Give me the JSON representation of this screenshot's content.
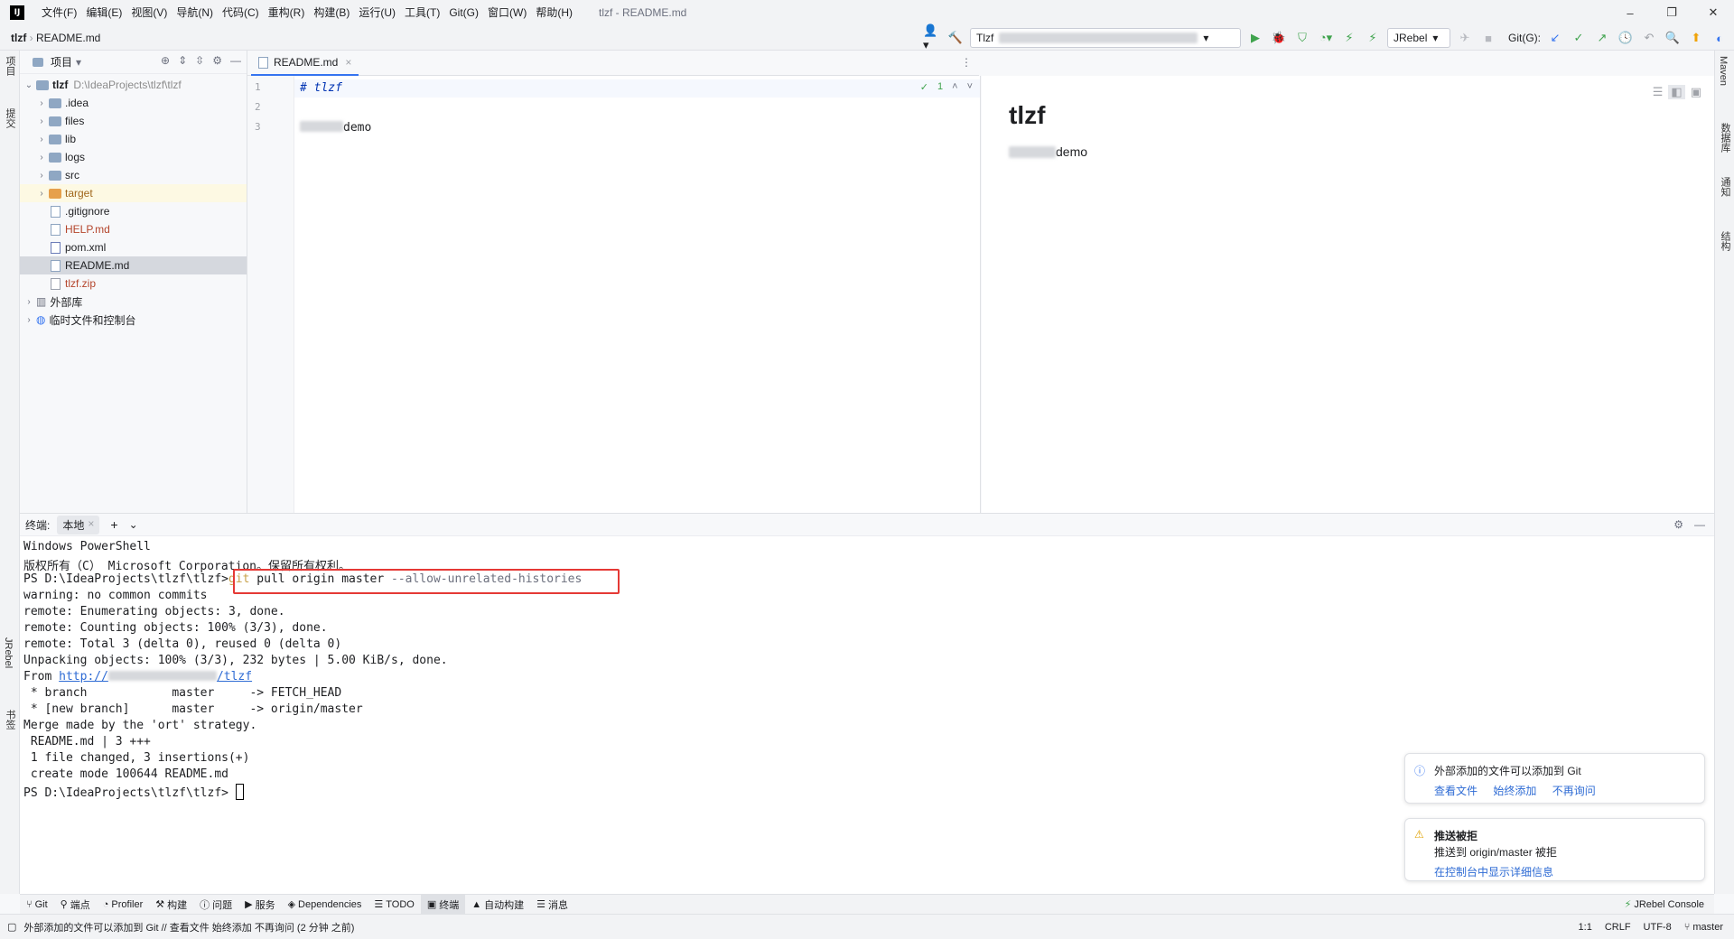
{
  "titlebar": {
    "menu": [
      "文件(F)",
      "编辑(E)",
      "视图(V)",
      "导航(N)",
      "代码(C)",
      "重构(R)",
      "构建(B)",
      "运行(U)",
      "工具(T)",
      "Git(G)",
      "窗口(W)",
      "帮助(H)"
    ],
    "window_title": "tlzf - README.md",
    "minimize": "–",
    "maximize": "❐",
    "close": "✕"
  },
  "navbar": {
    "project": "tlzf",
    "file": "README.md",
    "run_config": "Tlzf",
    "jrebel": "JRebel",
    "git_label": "Git(G):"
  },
  "left_strip": {
    "project_tab": "项目",
    "commit_tab": "提交",
    "jrebel_tab": "JRebel",
    "bookmarks_tab": "书签"
  },
  "right_strip": {
    "maven_tab": "Maven",
    "database_tab": "数据库",
    "notifications_tab": "通知",
    "structure_tab": "结构"
  },
  "project_panel": {
    "title": "项目",
    "root": {
      "name": "tlzf",
      "path": "D:\\IdeaProjects\\tlzf\\tlzf"
    },
    "items": [
      {
        "name": ".idea",
        "kind": "folder"
      },
      {
        "name": "files",
        "kind": "folder"
      },
      {
        "name": "lib",
        "kind": "folder"
      },
      {
        "name": "logs",
        "kind": "folder"
      },
      {
        "name": "src",
        "kind": "folder"
      },
      {
        "name": "target",
        "kind": "folder-excluded"
      },
      {
        "name": ".gitignore",
        "kind": "file"
      },
      {
        "name": "HELP.md",
        "kind": "file"
      },
      {
        "name": "pom.xml",
        "kind": "file"
      },
      {
        "name": "README.md",
        "kind": "file"
      },
      {
        "name": "tlzf.zip",
        "kind": "file"
      }
    ],
    "external_libs": "外部库",
    "scratches": "临时文件和控制台"
  },
  "editor": {
    "tab_label": "README.md",
    "line_numbers": [
      "1",
      "2",
      "3"
    ],
    "line1": "# tlzf",
    "line3_suffix": "demo",
    "inspection_count": "1"
  },
  "preview": {
    "heading": "tlzf",
    "paragraph_suffix": "demo"
  },
  "terminal": {
    "title": "终端:",
    "tab_local": "本地",
    "lines": [
      "Windows PowerShell",
      "版权所有（C） Microsoft Corporation。保留所有权利。",
      "",
      "warning: no common commits",
      "remote: Enumerating objects: 3, done.",
      "remote: Counting objects: 100% (3/3), done.",
      "remote: Total 3 (delta 0), reused 0 (delta 0)",
      "Unpacking objects: 100% (3/3), 232 bytes | 5.00 KiB/s, done.",
      "",
      " * branch            master     -> FETCH_HEAD",
      " * [new branch]      master     -> origin/master",
      "Merge made by the 'ort' strategy.",
      " README.md | 3 +++",
      " 1 file changed, 3 insertions(+)",
      " create mode 100644 README.md"
    ],
    "prompt": "PS D:\\IdeaProjects\\tlzf\\tlzf>",
    "command_git": "git",
    "command_rest": " pull origin master ",
    "command_flag": "--allow-unrelated-histories",
    "from_label": "From ",
    "from_url_prefix": "http://",
    "from_url_suffix": "/tlzf",
    "highlight_color": "#e53935"
  },
  "notifications": [
    {
      "title": "外部添加的文件可以添加到 Git",
      "actions": [
        "查看文件",
        "始终添加",
        "不再询问"
      ]
    },
    {
      "title": "推送被拒",
      "body": "推送到 origin/master 被拒",
      "action": "在控制台中显示详细信息"
    }
  ],
  "bottom_tools": [
    "Git",
    "端点",
    "Profiler",
    "构建",
    "问题",
    "服务",
    "Dependencies",
    "TODO",
    "终端",
    "自动构建",
    "消息"
  ],
  "bottom_right": "JRebel Console",
  "statusbar": {
    "message": "外部添加的文件可以添加到 Git // 查看文件   始终添加   不再询问 (2 分钟 之前)",
    "position": "1:1",
    "line_sep": "CRLF",
    "encoding": "UTF-8",
    "branch": "master"
  }
}
